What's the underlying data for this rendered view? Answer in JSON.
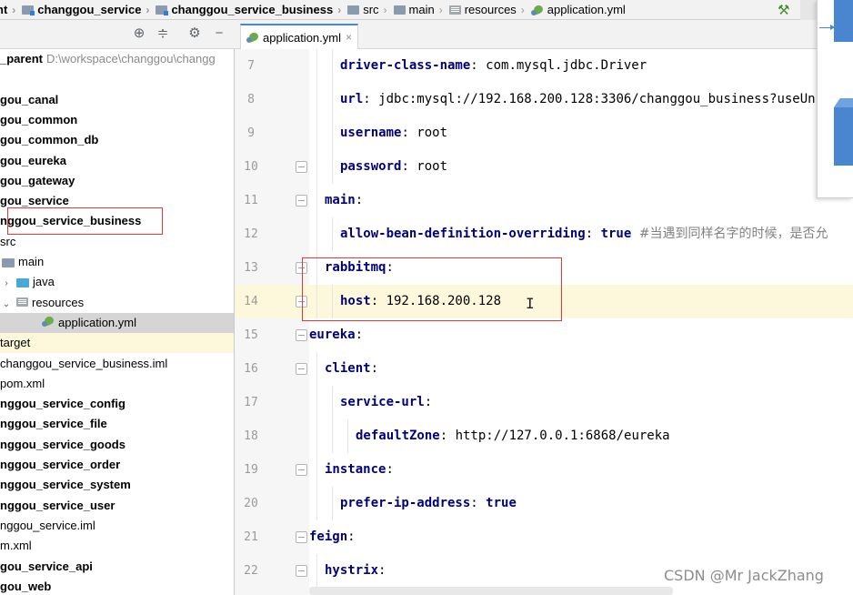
{
  "breadcrumb": [
    {
      "label": "nt",
      "icon": "module-folder-icon",
      "bold": true
    },
    {
      "label": "changgou_service",
      "icon": "module-folder-icon",
      "bold": true
    },
    {
      "label": "changgou_service_business",
      "icon": "module-folder-icon",
      "bold": true
    },
    {
      "label": "src",
      "icon": "folder-icon",
      "bold": false
    },
    {
      "label": "main",
      "icon": "folder-icon",
      "bold": false
    },
    {
      "label": "resources",
      "icon": "resources-folder-icon",
      "bold": false
    },
    {
      "label": "application.yml",
      "icon": "yml-file-icon",
      "bold": false
    }
  ],
  "editor": {
    "tab_label": "application.yml",
    "tab_close": "×",
    "lines": [
      {
        "no": "7",
        "indent": 2,
        "key": "driver-class-name",
        "value": "com.mysql.jdbc.Driver"
      },
      {
        "no": "8",
        "indent": 2,
        "key": "url",
        "value": "jdbc:mysql://192.168.200.128:3306/changgou_business?useUn"
      },
      {
        "no": "9",
        "indent": 2,
        "key": "username",
        "value": "root"
      },
      {
        "no": "10",
        "indent": 2,
        "key": "password",
        "value": "root"
      },
      {
        "no": "11",
        "indent": 1,
        "key": "main",
        "value": ""
      },
      {
        "no": "12",
        "indent": 2,
        "key": "allow-bean-definition-overriding",
        "value": "true",
        "comment": "#当遇到同样名字的时候，是否允"
      },
      {
        "no": "13",
        "indent": 1,
        "key": "rabbitmq",
        "value": ""
      },
      {
        "no": "14",
        "indent": 2,
        "key": "host",
        "value": "192.168.200.128",
        "current": true
      },
      {
        "no": "15",
        "indent": 0,
        "key": "eureka",
        "value": ""
      },
      {
        "no": "16",
        "indent": 1,
        "key": "client",
        "value": ""
      },
      {
        "no": "17",
        "indent": 2,
        "key": "service-url",
        "value": ""
      },
      {
        "no": "18",
        "indent": 3,
        "key": "defaultZone",
        "value": "http://127.0.0.1:6868/eureka"
      },
      {
        "no": "19",
        "indent": 1,
        "key": "instance",
        "value": ""
      },
      {
        "no": "20",
        "indent": 2,
        "key": "prefer-ip-address",
        "value": "true"
      },
      {
        "no": "21",
        "indent": 0,
        "key": "feign",
        "value": ""
      },
      {
        "no": "22",
        "indent": 1,
        "key": "hystrix",
        "value": ""
      }
    ]
  },
  "project_tree": [
    {
      "label": "_parent",
      "path": "D:\\workspace\\changgou\\changg",
      "bold": true
    },
    {
      "label": "",
      "bold": false
    },
    {
      "label": "gou_canal",
      "bold": true
    },
    {
      "label": "gou_common",
      "bold": true
    },
    {
      "label": "gou_common_db",
      "bold": true
    },
    {
      "label": "gou_eureka",
      "bold": true
    },
    {
      "label": "gou_gateway",
      "bold": true
    },
    {
      "label": "gou_service",
      "bold": true
    },
    {
      "label": "nggou_service_business",
      "bold": true
    },
    {
      "label": "src",
      "bold": false
    },
    {
      "label": "main",
      "bold": false,
      "icon": "folder"
    },
    {
      "label": "java",
      "bold": false,
      "icon": "java-folder",
      "arrow": "›"
    },
    {
      "label": "resources",
      "bold": false,
      "icon": "resources-folder",
      "arrow": "⌄"
    },
    {
      "label": "application.yml",
      "bold": false,
      "icon": "yml",
      "selected": true
    },
    {
      "label": "target",
      "bold": false,
      "highlight": true
    },
    {
      "label": "changgou_service_business.iml",
      "bold": false
    },
    {
      "label": "pom.xml",
      "bold": false
    },
    {
      "label": "nggou_service_config",
      "bold": true
    },
    {
      "label": "nggou_service_file",
      "bold": true
    },
    {
      "label": "nggou_service_goods",
      "bold": true
    },
    {
      "label": "nggou_service_order",
      "bold": true
    },
    {
      "label": "nggou_service_system",
      "bold": true
    },
    {
      "label": "nggou_service_user",
      "bold": true
    },
    {
      "label": "nggou_service.iml",
      "bold": false
    },
    {
      "label": "m.xml",
      "bold": false
    },
    {
      "label": "gou_service_api",
      "bold": true
    },
    {
      "label": "gou_web",
      "bold": true
    }
  ],
  "project_toolbar_icons": [
    "crosshair-icon",
    "collapse-icon",
    "gear-icon",
    "minimize-icon"
  ],
  "watermark": "CSDN @Mr JackZhang",
  "colors": {
    "key": "#000080",
    "comment": "#808080",
    "current_line": "#fdf8dc",
    "annotation_box": "#e53935"
  }
}
